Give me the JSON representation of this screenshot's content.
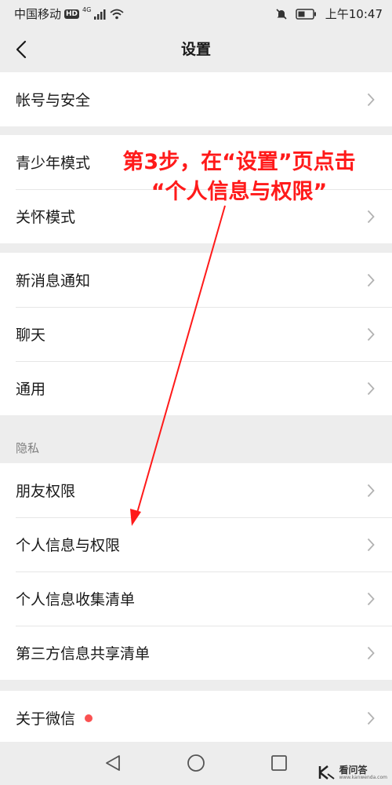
{
  "status_bar": {
    "carrier": "中国移动",
    "hd_badge": "HD",
    "network": "4G",
    "time": "上午10:47"
  },
  "nav": {
    "title": "设置"
  },
  "groups": [
    {
      "items": [
        {
          "label": "帐号与安全"
        }
      ]
    },
    {
      "items": [
        {
          "label": "青少年模式"
        },
        {
          "label": "关怀模式"
        }
      ]
    },
    {
      "items": [
        {
          "label": "新消息通知"
        },
        {
          "label": "聊天"
        },
        {
          "label": "通用"
        }
      ]
    },
    {
      "items": [
        {
          "label": "朋友权限"
        },
        {
          "label": "个人信息与权限"
        },
        {
          "label": "个人信息收集清单"
        },
        {
          "label": "第三方信息共享清单"
        }
      ]
    },
    {
      "items": [
        {
          "label": "关于微信"
        }
      ]
    }
  ],
  "section_privacy": "隐私",
  "annotation": {
    "line1": "第3步，在“设置”页点击",
    "line2": "“个人信息与权限”"
  },
  "watermark": {
    "text": "看问答",
    "url": "www.kanwenda.com"
  },
  "colors": {
    "background": "#ededed",
    "annotation": "#ff1a1a",
    "badge_dot": "#fa5151"
  }
}
